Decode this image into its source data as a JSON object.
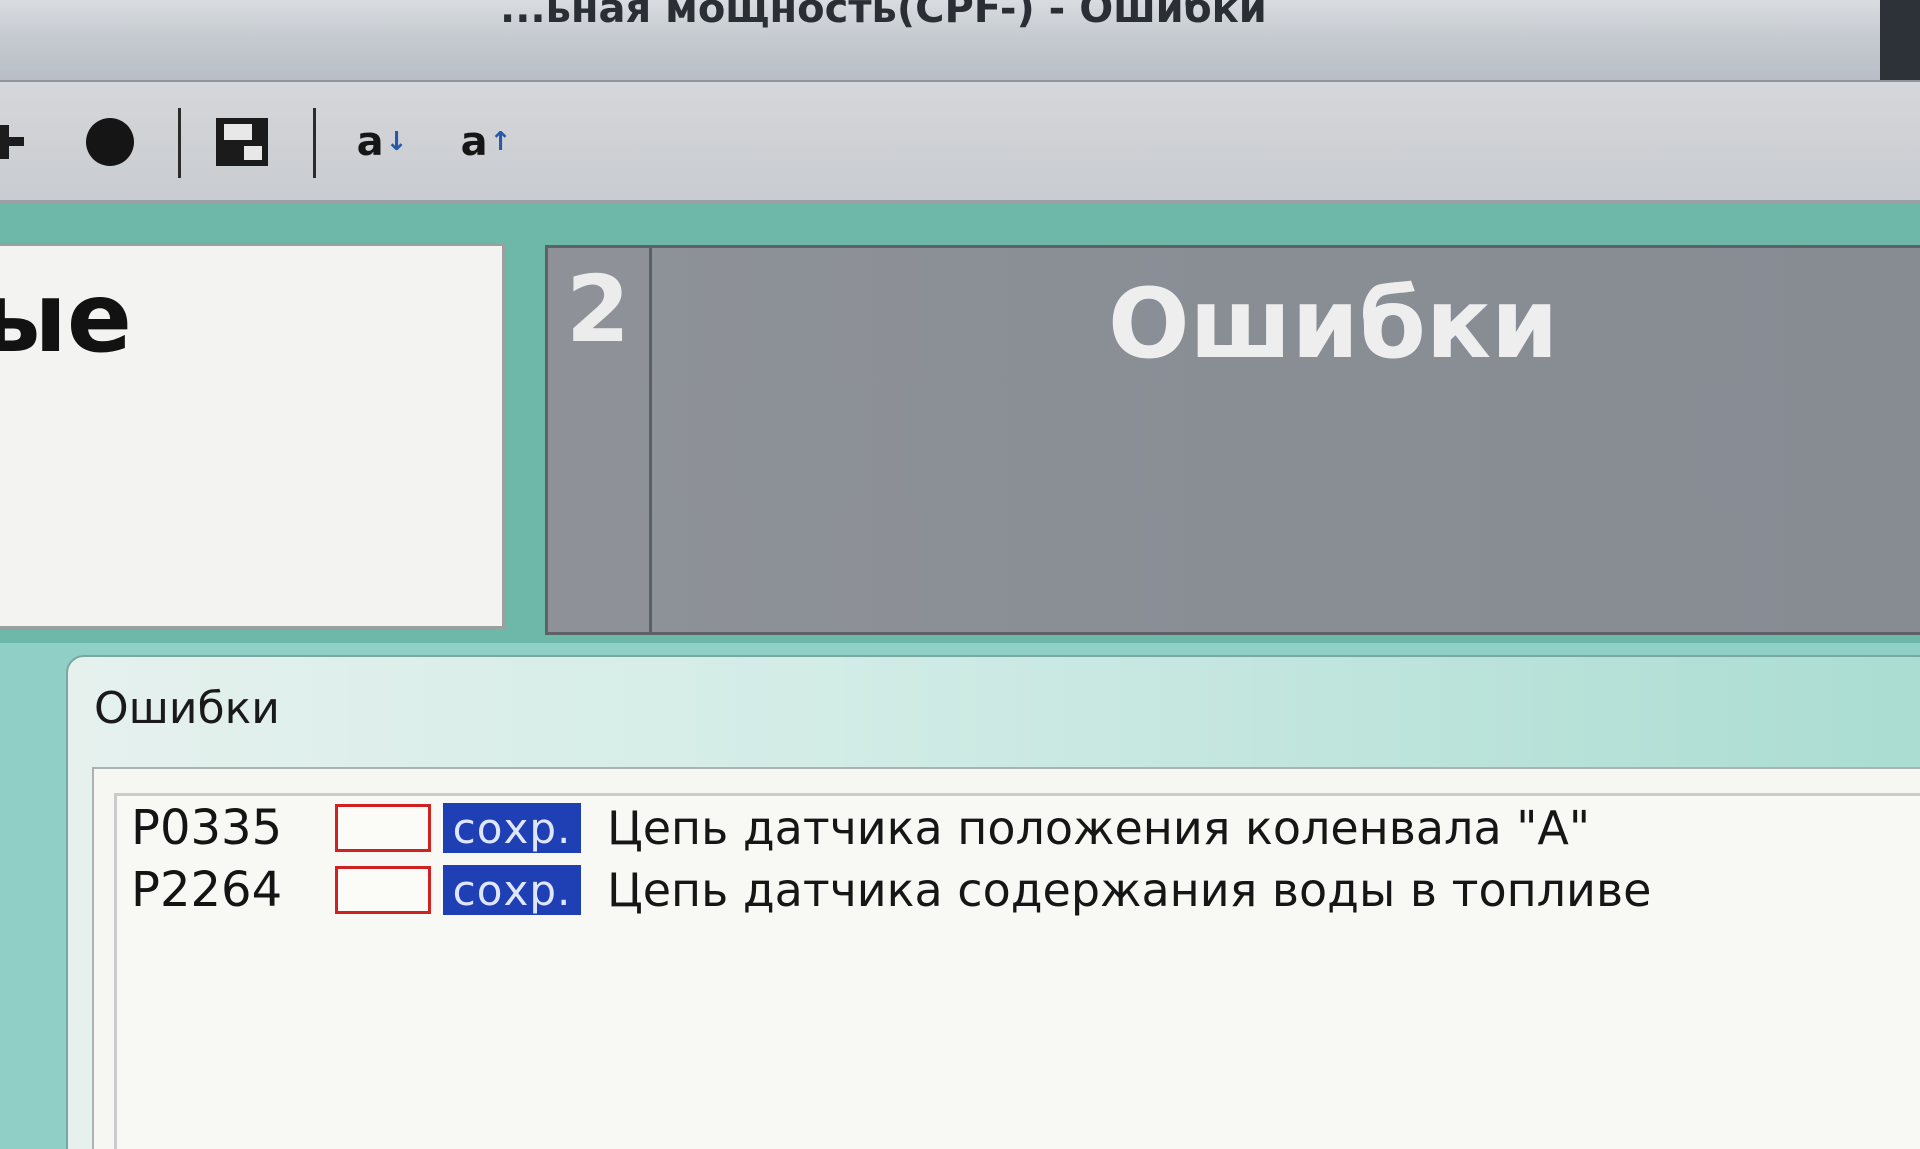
{
  "window": {
    "title": "...ьная мощность(CPF-) - Ошибки"
  },
  "toolbar": {
    "items": [
      {
        "icon": "plus-icon"
      },
      {
        "icon": "record-icon"
      },
      {
        "icon": "save-icon"
      },
      {
        "label": "a",
        "icon": "sort-descending-icon",
        "arrow": "↓"
      },
      {
        "label": "a",
        "icon": "sort-ascending-icon",
        "arrow": "↑"
      }
    ]
  },
  "panels": {
    "left_title_partial": "ые",
    "right_number": "2",
    "right_title": "Ошибки"
  },
  "errors": {
    "caption": "Ошибки",
    "rows": [
      {
        "code": "P0335",
        "status": "сохр.",
        "description": "Цепь датчика положения коленвала \"А\""
      },
      {
        "code": "P2264",
        "status": "сохр.",
        "description": "Цепь датчика содержания воды в топливе"
      }
    ]
  },
  "colors": {
    "background_accent": "#8fcfc6",
    "status_badge": "#1f3fb5",
    "checkbox_border": "#d12222",
    "panel_dark": "#898e95"
  }
}
